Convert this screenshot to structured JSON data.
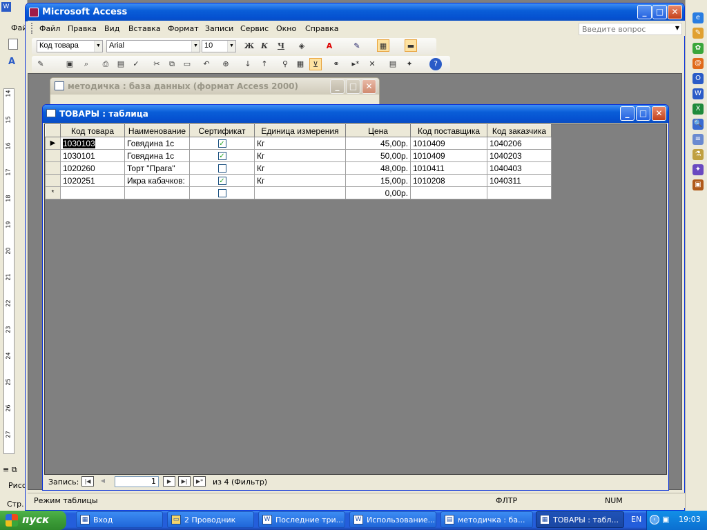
{
  "word_bg": {
    "menu_fragment": "Фай",
    "page_fragment": "Стр.",
    "draw_fragment": "Рисо",
    "ruler_numbers": [
      "14",
      "15",
      "16",
      "17",
      "18",
      "19",
      "20",
      "21",
      "22",
      "23",
      "24",
      "25",
      "26",
      "27"
    ]
  },
  "access": {
    "title": "Microsoft Access",
    "menu": [
      "Файл",
      "Правка",
      "Вид",
      "Вставка",
      "Формат",
      "Записи",
      "Сервис",
      "Окно",
      "Справка"
    ],
    "help_placeholder": "Введите вопрос",
    "field_combo": "Код товара",
    "font_combo": "Arial",
    "size_combo": "10",
    "bold": "Ж",
    "italic": "К",
    "underline": "Ч",
    "status_left": "Режим таблицы",
    "status_filter": "ФЛТР",
    "status_num": "NUM"
  },
  "db_window": {
    "title": "методичка : база данных (формат Access 2000)"
  },
  "table_window": {
    "title": "ТОВАРЫ : таблица",
    "columns": [
      "Код товара",
      "Наименование",
      "Сертификат",
      "Единица измерения",
      "Цена",
      "Код поставщика",
      "Код заказчика"
    ],
    "rows": [
      {
        "code": "1030103",
        "name": "Говядина 1с",
        "cert": true,
        "unit": "Кг",
        "price": "45,00р.",
        "supplier": "1010409",
        "customer": "1040206"
      },
      {
        "code": "1030101",
        "name": "Говядина 1с",
        "cert": true,
        "unit": "Кг",
        "price": "50,00р.",
        "supplier": "1010409",
        "customer": "1040203"
      },
      {
        "code": "1020260",
        "name": "Торт \"Прага\"",
        "cert": false,
        "unit": "Кг",
        "price": "48,00р.",
        "supplier": "1010411",
        "customer": "1040403"
      },
      {
        "code": "1020251",
        "name": "Икра кабачков:",
        "cert": true,
        "unit": "Кг",
        "price": "15,00р.",
        "supplier": "1010208",
        "customer": "1040311"
      }
    ],
    "new_row_price": "0,00р.",
    "nav_label": "Запись:",
    "nav_current": "1",
    "nav_total": "из 4 (Фильтр)"
  },
  "taskbar": {
    "start": "пуск",
    "items": [
      "Вход",
      "2 Проводник",
      "Последние три...",
      "Использование...",
      "методичка : ба...",
      "ТОВАРЫ : табл..."
    ],
    "lang": "EN",
    "clock": "19:03"
  }
}
